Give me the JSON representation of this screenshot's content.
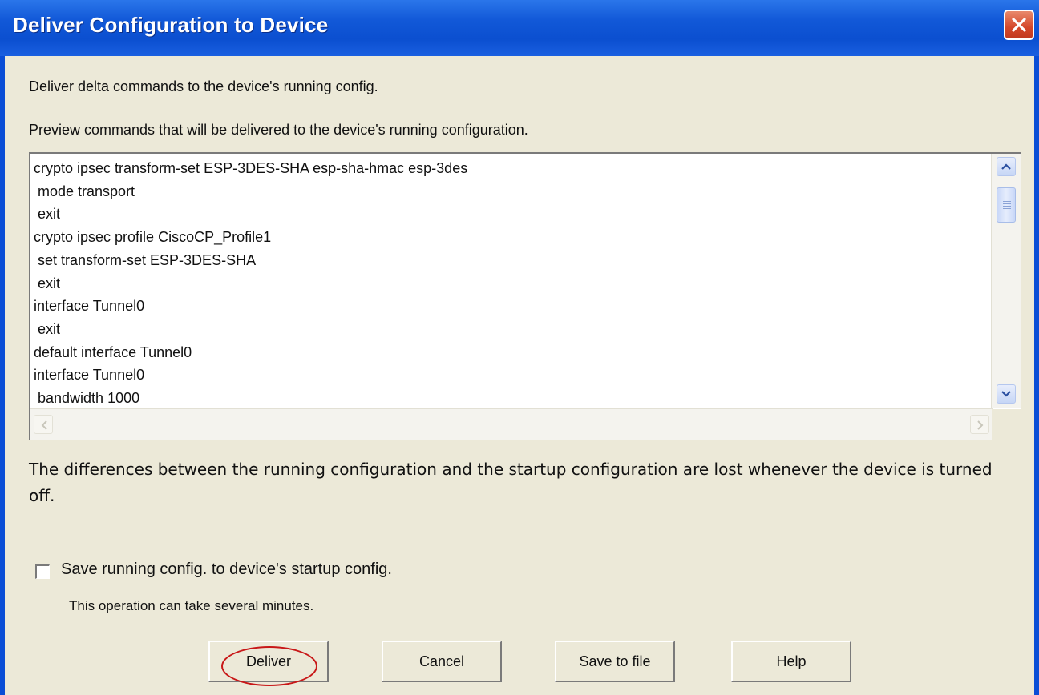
{
  "window": {
    "title": "Deliver Configuration to Device",
    "close_icon": "close-icon",
    "accent_color": "#0a4ed6",
    "close_color": "#d4472a"
  },
  "content": {
    "intro": "Deliver delta commands to the device's running config.",
    "preview_label": "Preview commands that will be delivered to the device's running configuration.",
    "commands": "crypto ipsec transform-set ESP-3DES-SHA esp-sha-hmac esp-3des\n mode transport\n exit\ncrypto ipsec profile CiscoCP_Profile1\n set transform-set ESP-3DES-SHA\n exit\ninterface Tunnel0\n exit\ndefault interface Tunnel0\ninterface Tunnel0\n bandwidth 1000",
    "warning": "The differences between the running configuration and the startup configuration are lost whenever the device is turned off.",
    "save_checkbox_label": "Save running config. to device's startup config.",
    "save_checkbox_checked": false,
    "note": "This operation can take several minutes."
  },
  "buttons": {
    "deliver": "Deliver",
    "cancel": "Cancel",
    "save_to_file": "Save to file",
    "help": "Help"
  },
  "annotation": {
    "highlight_color": "#c81818"
  }
}
